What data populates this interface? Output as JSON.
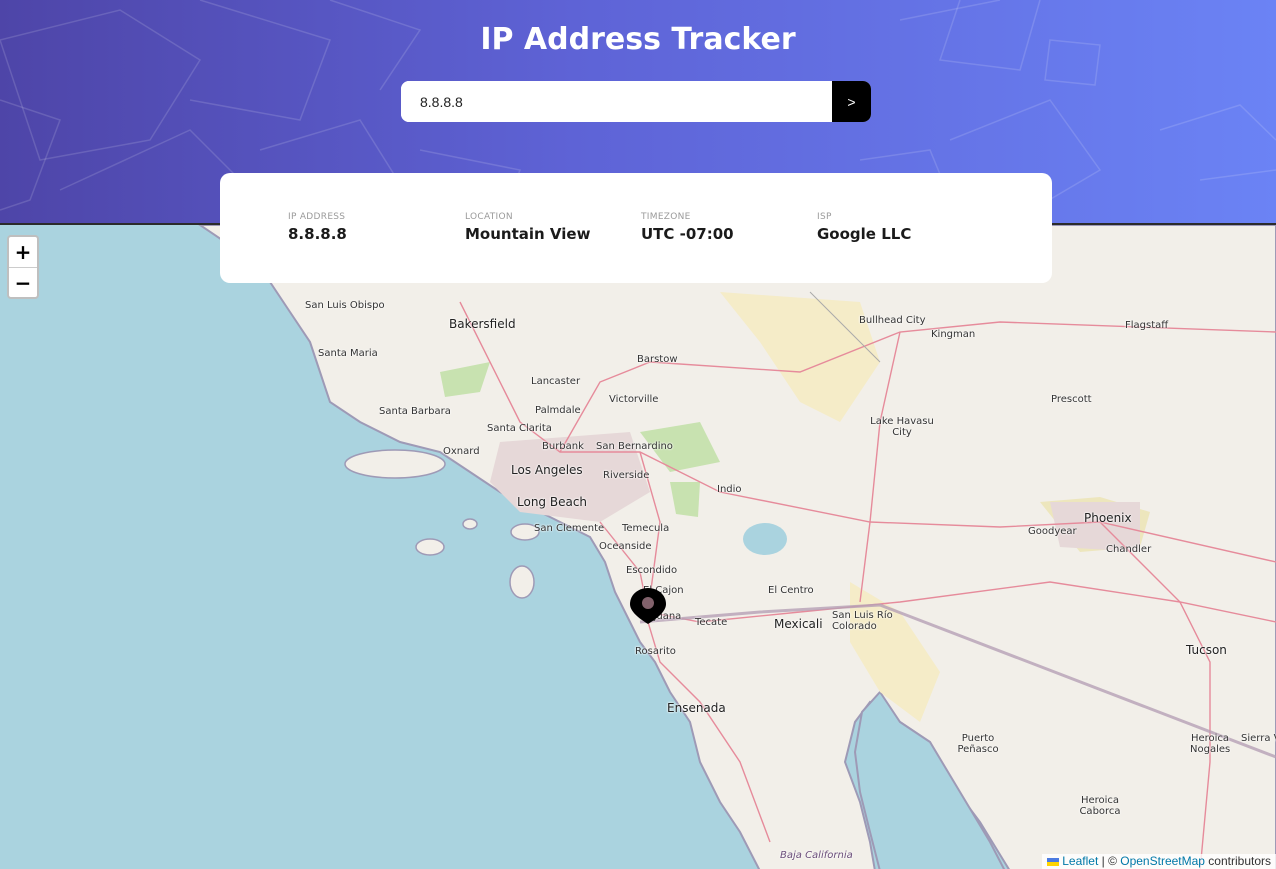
{
  "header": {
    "title": "IP Address Tracker",
    "search": {
      "value": "8.8.8.8",
      "button_label": ">"
    }
  },
  "info": [
    {
      "label": "IP ADDRESS",
      "value": "8.8.8.8"
    },
    {
      "label": "LOCATION",
      "value": "Mountain View"
    },
    {
      "label": "TIMEZONE",
      "value": "UTC -07:00"
    },
    {
      "label": "ISP",
      "value": "Google LLC"
    }
  ],
  "map": {
    "zoom_in_label": "+",
    "zoom_out_label": "−",
    "attribution": {
      "leaflet": "Leaflet",
      "separator": " | © ",
      "osm": "OpenStreetMap",
      "suffix": " contributors"
    },
    "labels": [
      "San Luis Obispo",
      "Bakersfield",
      "Bullhead City",
      "Kingman",
      "Flagstaff",
      "Santa Maria",
      "Barstow",
      "Lancaster",
      "Palmdale",
      "Victorville",
      "Prescott",
      "Santa Barbara",
      "Lake Havasu City",
      "Santa Clarita",
      "Burbank",
      "San Bernardino",
      "Oxnard",
      "Los Angeles",
      "Riverside",
      "Long Beach",
      "Indio",
      "Phoenix",
      "Goodyear",
      "Chandler",
      "San Clemente",
      "Temecula",
      "Oceanside",
      "Escondido",
      "El Centro",
      "El Cajon",
      "San Luis Río Colorado",
      "Tijuana",
      "Tecate",
      "Mexicali",
      "Rosarito",
      "Tucson",
      "Ensenada",
      "Puerto Peñasco",
      "Heroica Nogales",
      "Sierra V",
      "Heroica Caborca",
      "Baja California"
    ]
  }
}
